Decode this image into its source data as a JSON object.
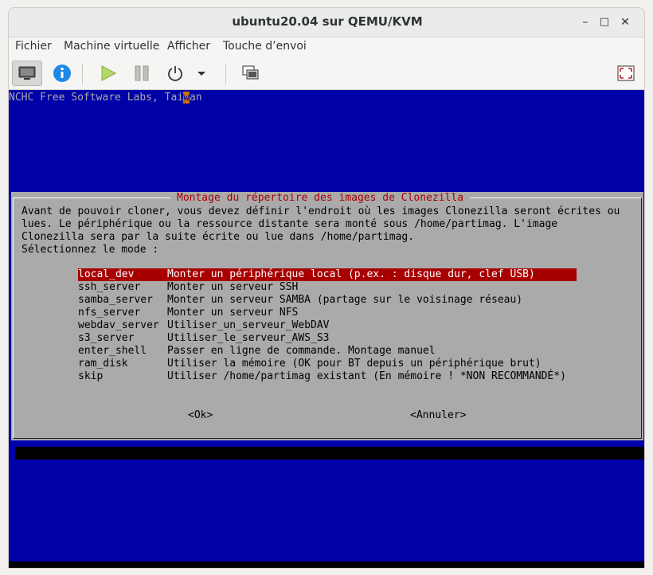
{
  "window": {
    "title": "ubuntu20.04 sur QEMU/KVM"
  },
  "window_controls": {
    "minimize": "–",
    "maximize": "□",
    "close": "✕"
  },
  "menu": [
    "Fichier",
    "Machine virtuelle",
    "Afficher",
    "Touche d’envoi"
  ],
  "toolbar": {
    "icons": [
      "monitor-icon",
      "info-icon",
      "play-icon",
      "pause-icon",
      "power-icon",
      "chevron-down-icon",
      "snapshot-icon",
      "fullscreen-icon"
    ],
    "accent_play": "#9ccc65",
    "accent_info": "#1e88e5"
  },
  "console": {
    "top_text_before": "NCHC Free Software Labs, Tai",
    "top_text_cursor": "w",
    "top_text_after": "an",
    "background": "#0000a8",
    "dialog": {
      "title": "Montage du répertoire des images de Clonezilla",
      "text": "Avant de pouvoir cloner, vous devez définir l'endroit où les images Clonezilla seront écrites ou\nlues. Le périphérique ou la ressource distante sera monté sous /home/partimag. L'image\nClonezilla sera par la suite écrite ou lue dans /home/partimag.\nSélectionnez le mode :",
      "options": [
        {
          "key": "local_dev",
          "desc": "Monter un périphérique local (p.ex. : disque dur, clef USB)",
          "selected": true
        },
        {
          "key": "ssh_server",
          "desc": "Monter un serveur SSH"
        },
        {
          "key": "samba_server",
          "desc": "Monter un serveur SAMBA (partage sur le voisinage réseau)"
        },
        {
          "key": "nfs_server",
          "desc": "Monter un serveur NFS"
        },
        {
          "key": "webdav_server",
          "desc": "Utiliser_un_serveur_WebDAV"
        },
        {
          "key": "s3_server",
          "desc": "Utiliser_le_serveur_AWS_S3"
        },
        {
          "key": "enter_shell",
          "desc": "Passer en ligne de commande. Montage manuel"
        },
        {
          "key": "ram_disk",
          "desc": "Utiliser la mémoire (OK pour BT depuis un périphérique brut)"
        },
        {
          "key": "skip",
          "desc": "Utiliser /home/partimag existant (En mémoire ! *NON RECOMMANDÉ*)"
        }
      ],
      "ok_label": "<Ok>",
      "cancel_label": "<Annuler>"
    }
  }
}
